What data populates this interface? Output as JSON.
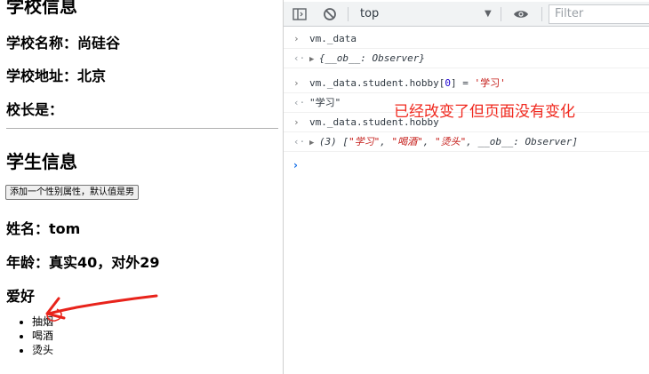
{
  "page": {
    "school_heading": "学校信息",
    "school_name_label": "学校名称：",
    "school_name": "尚硅谷",
    "school_address_label": "学校地址：",
    "school_address": "北京",
    "principal_label": "校长是：",
    "student_heading": "学生信息",
    "add_gender_button": "添加一个性别属性，默认值是男",
    "name_line": "姓名：tom",
    "age_line": "年龄：真实40，对外29",
    "hobbies_heading": "爱好",
    "hobbies": [
      "抽烟",
      "喝酒",
      "烫头"
    ]
  },
  "devtools": {
    "context": "top",
    "filter_placeholder": "Filter",
    "console": [
      {
        "kind": "input",
        "text": "vm._data"
      },
      {
        "kind": "output",
        "text": "{__ob__: Observer}"
      },
      {
        "kind": "input",
        "prefix": "vm._data.student.hobby[",
        "index": "0",
        "middle": "] = ",
        "value": "'学习'"
      },
      {
        "kind": "output",
        "text": "\"学习\""
      },
      {
        "kind": "input",
        "text": "vm._data.student.hobby"
      },
      {
        "kind": "output",
        "count": "(3) [",
        "items": [
          "\"学习\"",
          "\"喝酒\"",
          "\"烫头\""
        ],
        "sep": ", ",
        "tail": "__ob__: Observer]"
      }
    ],
    "annotation": "已经改变了但页面没有变化"
  },
  "colors": {
    "annotation_red": "#f0281e",
    "string_red": "#c41a16",
    "prompt_blue": "#1a73e8"
  }
}
